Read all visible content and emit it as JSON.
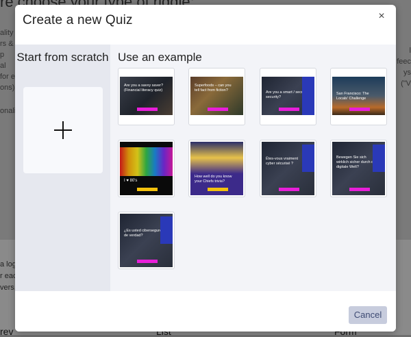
{
  "background": {
    "title_fragment": "re   choose your type of riddle:",
    "left_fragments": [
      "ality",
      "rs & p",
      "al for e",
      "ons).",
      "onali"
    ],
    "right_fragments": [
      "l feec",
      "ys (\"V"
    ],
    "lower_left_fragments": [
      "a logic",
      "r each",
      "vers.",
      "rev"
    ],
    "bottom_labels": [
      "List",
      "Form"
    ]
  },
  "modal": {
    "title": "Create a new Quiz",
    "close_label": "×",
    "scratch": {
      "title": "Start from scratch"
    },
    "examples": {
      "title": "Use an example",
      "items": [
        {
          "text": "Are you a savvy saver? (Financial literacy quiz)"
        },
        {
          "text": "Superfoods – can you tell fact from fiction?"
        },
        {
          "text": "Are you a smart / secure security?"
        },
        {
          "text": "San Francisco: The Locals' Challenge"
        },
        {
          "text": "I ♥ 80's"
        },
        {
          "text": "How well do you know your Chiefs trivia?"
        },
        {
          "text": "Êtes-vous vraiment cyber sécurisé ?"
        },
        {
          "text": "Bewegen Sie sich wirklich sicher durch die digitale Welt?"
        },
        {
          "text": "¿Es usted cibersegure... de verdad?"
        }
      ]
    },
    "footer": {
      "cancel_label": "Cancel"
    }
  }
}
